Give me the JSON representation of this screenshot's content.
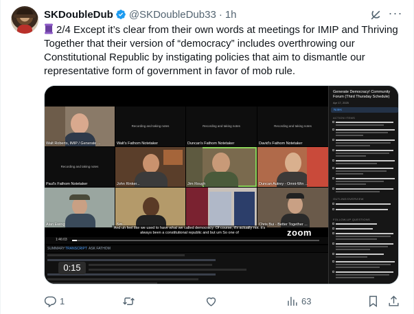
{
  "author": {
    "display_name": "SKDoubleDub",
    "handle": "@SKDoubleDub33",
    "time": "1h",
    "verified": true
  },
  "tweet": {
    "emoji": "scroll-icon",
    "text": "2/4 Except it’s clear from their own words at meetings for IMIP and Thriving Together that their version of “democracy” includes overthrowing our Constitutional Republic by instigating policies that aim to dismantle our representative form of government in favor of mob rule."
  },
  "media": {
    "panel_title": "Generate Democracy! Community Forum (Third Thursday Schedule)",
    "panel_date": "Apr 17, 2025",
    "panel_tab": "Notes",
    "panel_sections": [
      "ACTION ITEMS",
      "OUTLINE/OVERVIEW",
      "FOLLOW-UP QUESTIONS"
    ],
    "tiles": [
      {
        "label": "Walt Roberts, IMIP / Generate ...",
        "recording": ""
      },
      {
        "label": "Walt's Fathom Notetaker",
        "recording": "Recording and taking notes"
      },
      {
        "label": "Duncan's Fathom Notetaker",
        "recording": "Recording and taking notes"
      },
      {
        "label": "David's Fathom Notetaker",
        "recording": "Recording and taking notes"
      },
      {
        "label": "Paul's Fathom Notetaker",
        "recording": "Recording and taking notes"
      },
      {
        "label": "John Rinker...",
        "recording": ""
      },
      {
        "label": "Jim Rough",
        "recording": ""
      },
      {
        "label": "Duncan Autrey - Omni-Win ...",
        "recording": ""
      },
      {
        "label": "Alan Ewing",
        "recording": ""
      },
      {
        "label": "Sm...",
        "recording": ""
      },
      {
        "label": "",
        "recording": ""
      },
      {
        "label": "Chris Bui - Better Together ...",
        "recording": ""
      }
    ],
    "caption": "And uh feel like we used to have what we called democracy. Of course, it's actually not. It's always been a constitutional republic and but um So one of",
    "zoom_logo": "zoom",
    "timecode": "1:46:03",
    "tabs": [
      "SUMMARY",
      "TRANSCRIPT",
      "ASK FATHOM"
    ],
    "video_timestamp": "0:15",
    "playback_progress": 0.02
  },
  "actions": {
    "reply_count": "1",
    "repost_count": "",
    "like_count": "",
    "views_count": "63"
  },
  "colors": {
    "verified_blue": "#1d9bf0",
    "muted_text": "#536471",
    "speaker_highlight": "#8bd45a"
  }
}
